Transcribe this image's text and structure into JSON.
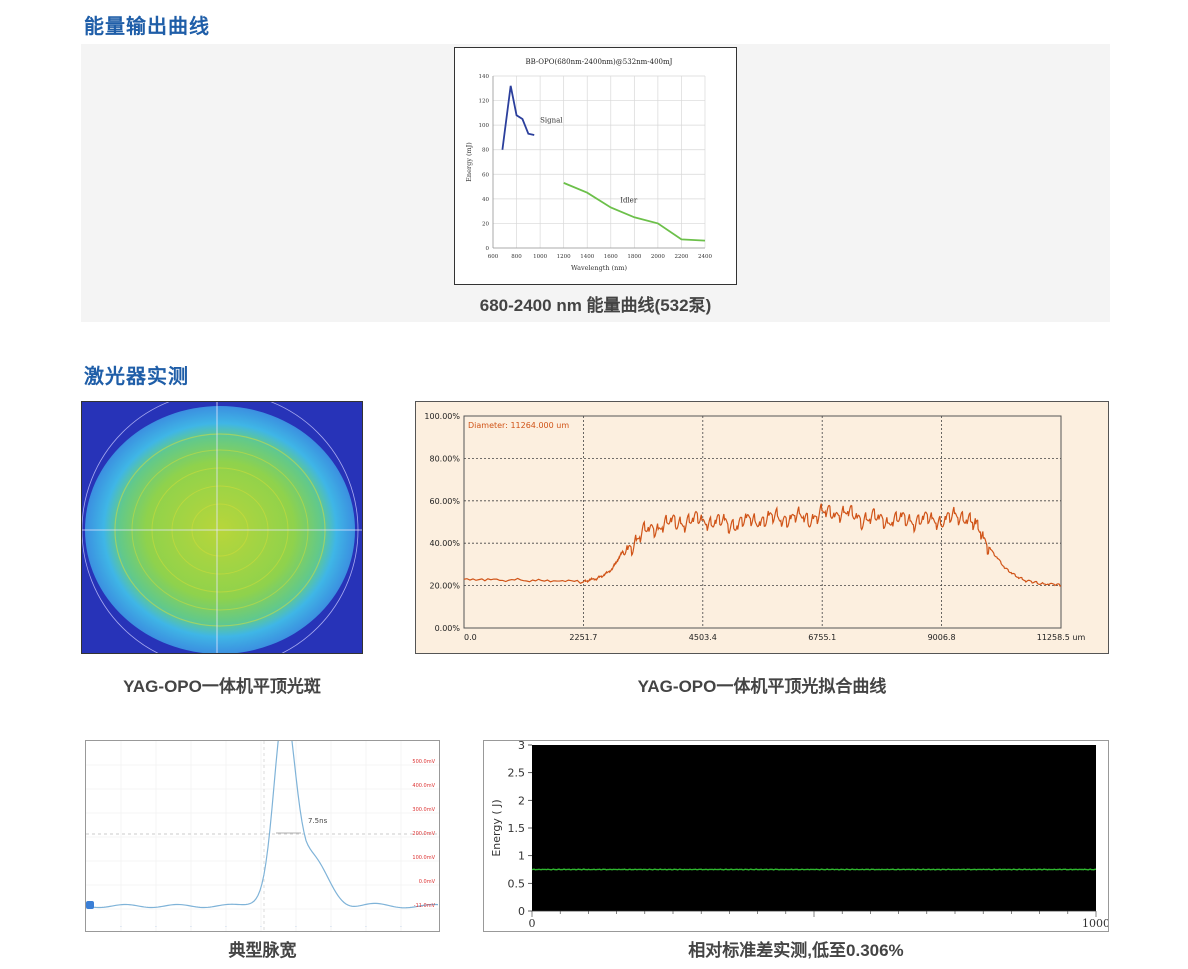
{
  "sections": {
    "energy_title": "能量输出曲线",
    "laser_title": "激光器实测"
  },
  "captions": {
    "energy_curve": "680-2400 nm 能量曲线(532泵)",
    "flat_top_spot": "YAG-OPO一体机平顶光斑",
    "flat_top_fit": "YAG-OPO一体机平顶光拟合曲线",
    "pulse_width": "典型脉宽",
    "stability": "相对标准差实测,低至0.306%"
  },
  "chart_data": [
    {
      "id": "energy_curve",
      "type": "line",
      "title": "BB-OPO(680nm-2400nm)@532nm-400mJ",
      "xlabel": "Wavelength (nm)",
      "ylabel": "Energy (mJ)",
      "xlim": [
        600,
        2400
      ],
      "ylim": [
        0,
        140
      ],
      "xticks": [
        600,
        800,
        1000,
        1200,
        1400,
        1600,
        1800,
        2000,
        2200,
        2400
      ],
      "yticks": [
        0,
        20,
        40,
        60,
        80,
        100,
        120,
        140
      ],
      "grid": true,
      "annotations": [
        "Signal",
        "Idler"
      ],
      "series": [
        {
          "name": "Signal",
          "color": "#2b3f9c",
          "x": [
            680,
            700,
            750,
            800,
            850,
            900,
            950
          ],
          "y": [
            80,
            95,
            132,
            108,
            105,
            93,
            92
          ]
        },
        {
          "name": "Idler",
          "color": "#6cc04a",
          "x": [
            1200,
            1400,
            1600,
            1800,
            2000,
            2200,
            2400
          ],
          "y": [
            53,
            45,
            33,
            25,
            20,
            7,
            6
          ]
        }
      ]
    },
    {
      "id": "flat_top_fit",
      "type": "line",
      "annotation": "Diameter: 11264.000 um",
      "xlim": [
        0,
        11258.5
      ],
      "ylim": [
        0,
        100
      ],
      "xticks": [
        "0.0",
        "2251.7",
        "4503.4",
        "6755.1",
        "9006.8",
        "11258.5 um"
      ],
      "yticks": [
        "0.00%",
        "20.00%",
        "40.00%",
        "60.00%",
        "80.00%",
        "100.00%"
      ],
      "grid": true,
      "series": [
        {
          "color": "#d05418",
          "x": [
            0,
            2250,
            2500,
            2800,
            3000,
            3500,
            4000,
            4500,
            5000,
            5500,
            6000,
            6500,
            7000,
            7500,
            8000,
            8500,
            9000,
            9500,
            9800,
            10200,
            10600,
            11258
          ],
          "y": [
            23,
            22,
            23,
            28,
            36,
            47,
            50,
            51,
            49,
            51,
            52,
            52,
            55,
            52,
            51,
            51,
            51,
            53,
            42,
            28,
            22,
            20
          ]
        }
      ]
    },
    {
      "id": "pulse_width",
      "type": "line",
      "annotation": "7.5ns",
      "right_labels": [
        "500.0mV",
        "400.0mV",
        "300.0mV",
        "200.0mV",
        "100.0mV",
        "0.0mV",
        "-11.0mV"
      ],
      "series": [
        {
          "color": "#7fb3d8",
          "fwhm_ns": 7.5
        }
      ]
    },
    {
      "id": "stability",
      "type": "scatter",
      "ylabel": "Energy ( J)",
      "xlim": [
        0,
        1000
      ],
      "ylim": [
        0,
        3
      ],
      "xticks": [
        "0",
        "1000"
      ],
      "yticks": [
        "0",
        "0.5",
        "1",
        "1.5",
        "2",
        "2.5",
        "3"
      ],
      "series": [
        {
          "color": "#2fb52f",
          "mean": 0.75,
          "rsd_percent": 0.306
        }
      ]
    }
  ],
  "images": {
    "flat_top_spot": {
      "icon": "beam-profile-image",
      "colors": [
        "#2733b8",
        "#3fb6e6",
        "#8bd24a",
        "#d6dd3a"
      ]
    }
  }
}
